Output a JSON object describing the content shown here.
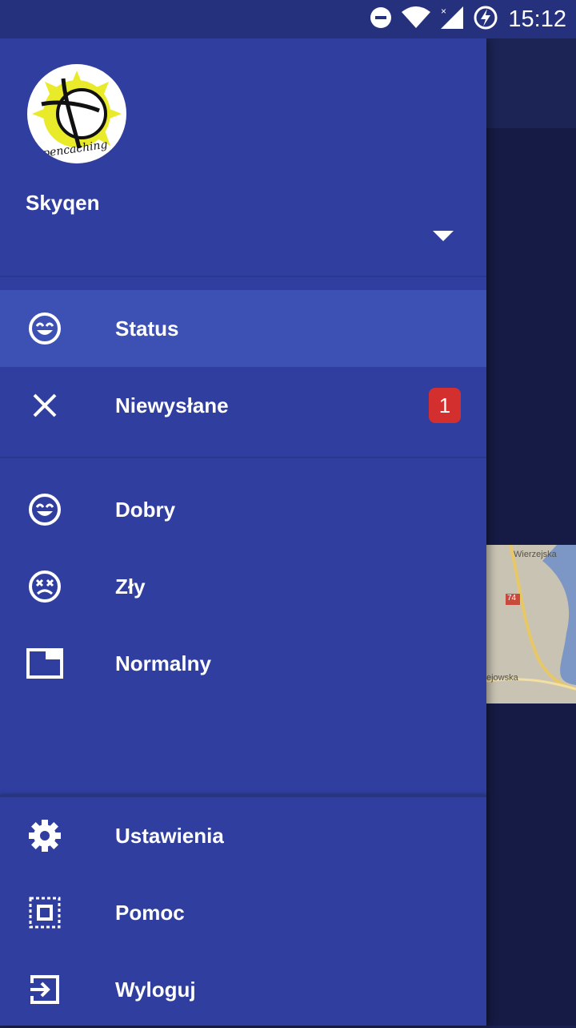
{
  "status_bar": {
    "time": "15:12",
    "icons": [
      "do-not-disturb-icon",
      "wifi-icon",
      "cell-signal-icon",
      "battery-charging-icon"
    ]
  },
  "header": {
    "username": "Skyqen",
    "avatar_logo_text": "Opencaching"
  },
  "menu": {
    "status": {
      "label": "Status",
      "icon": "happy-face-icon"
    },
    "unsent": {
      "label": "Niewysłane",
      "icon": "close-icon",
      "badge": "1"
    },
    "good": {
      "label": "Dobry",
      "icon": "happy-face-icon"
    },
    "bad": {
      "label": "Zły",
      "icon": "dead-face-icon"
    },
    "normal": {
      "label": "Normalny",
      "icon": "window-icon"
    },
    "settings": {
      "label": "Ustawienia",
      "icon": "gear-icon"
    },
    "help": {
      "label": "Pomoc",
      "icon": "select-all-icon"
    },
    "logout": {
      "label": "Wyloguj",
      "icon": "logout-icon"
    }
  },
  "map": {
    "street_top": "Wierzejska",
    "street_bottom": "ejowska",
    "road_number": "74"
  },
  "colors": {
    "drawer": "#303f9f",
    "active_item": "#3d51b5",
    "status_bar": "#26317d",
    "badge": "#d32f2f"
  }
}
